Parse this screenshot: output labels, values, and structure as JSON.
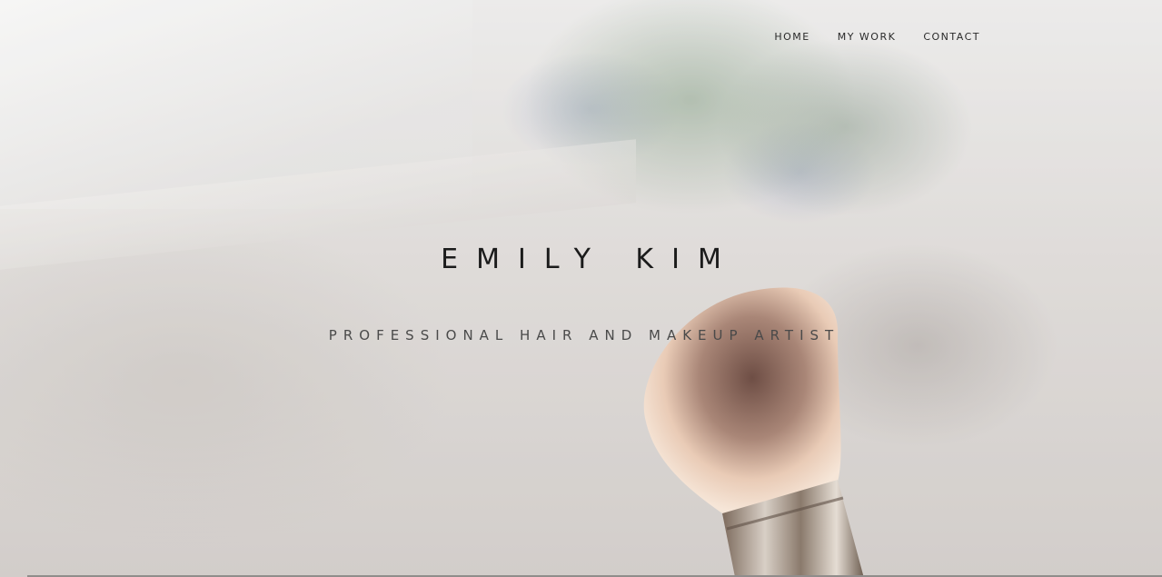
{
  "nav": {
    "items": [
      {
        "label": "HOME"
      },
      {
        "label": "MY WORK"
      },
      {
        "label": "CONTACT"
      }
    ]
  },
  "hero": {
    "title": "EMILY KIM",
    "subtitle": "PROFESSIONAL HAIR AND MAKEUP ARTIST"
  },
  "colors": {
    "text_primary": "#1b1b1b",
    "text_secondary": "#4a4a4a",
    "background": "#d9d6d4"
  }
}
